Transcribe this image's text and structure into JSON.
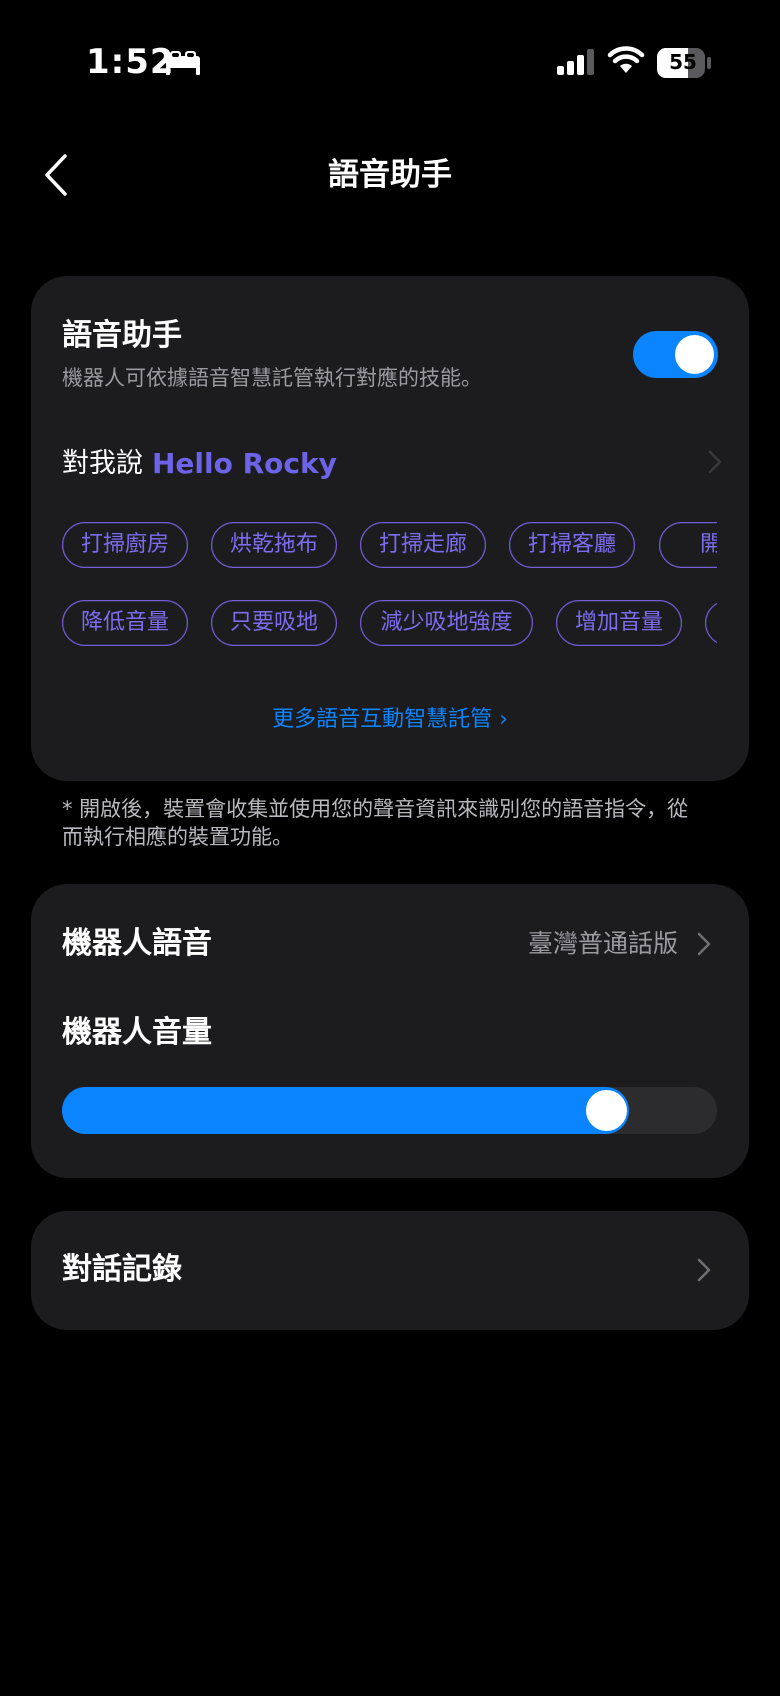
{
  "status_bar": {
    "time": "1:52",
    "battery": "55",
    "icons": [
      "bed-icon",
      "cellular-signal-icon",
      "wifi-icon",
      "battery-icon"
    ]
  },
  "nav": {
    "title": "語音助手",
    "back_icon": "chevron-left-icon"
  },
  "assistant": {
    "title": "語音助手",
    "description": "機器人可依據語音智慧託管執行對應的技能。",
    "toggle_on": true,
    "wake_label": "對我說",
    "wake_word": "Hello Rocky",
    "chips_row_1": [
      "打掃廚房",
      "烘乾拖布",
      "打掃走廊",
      "打掃客廳",
      "開始"
    ],
    "chips_row_2": [
      "降低音量",
      "只要吸地",
      "減少吸地強度",
      "增加音量",
      ""
    ],
    "more_link": "更多語音互動智慧託管 ›"
  },
  "disclaimer": "* 開啟後，裝置會收集並使用您的聲音資訊來識別您的語音指令，從而執行相應的裝置功能。",
  "robot_voice": {
    "label": "機器人語音",
    "value": "臺灣普通話版"
  },
  "robot_volume": {
    "label": "機器人音量",
    "level_percent": 83
  },
  "history": {
    "label": "對話記錄"
  },
  "colors": {
    "accent": "#0a84ff",
    "wake_word": "#6c63e8",
    "card_bg": "#1c1c1e",
    "chip_text": "#7b6cf0"
  }
}
